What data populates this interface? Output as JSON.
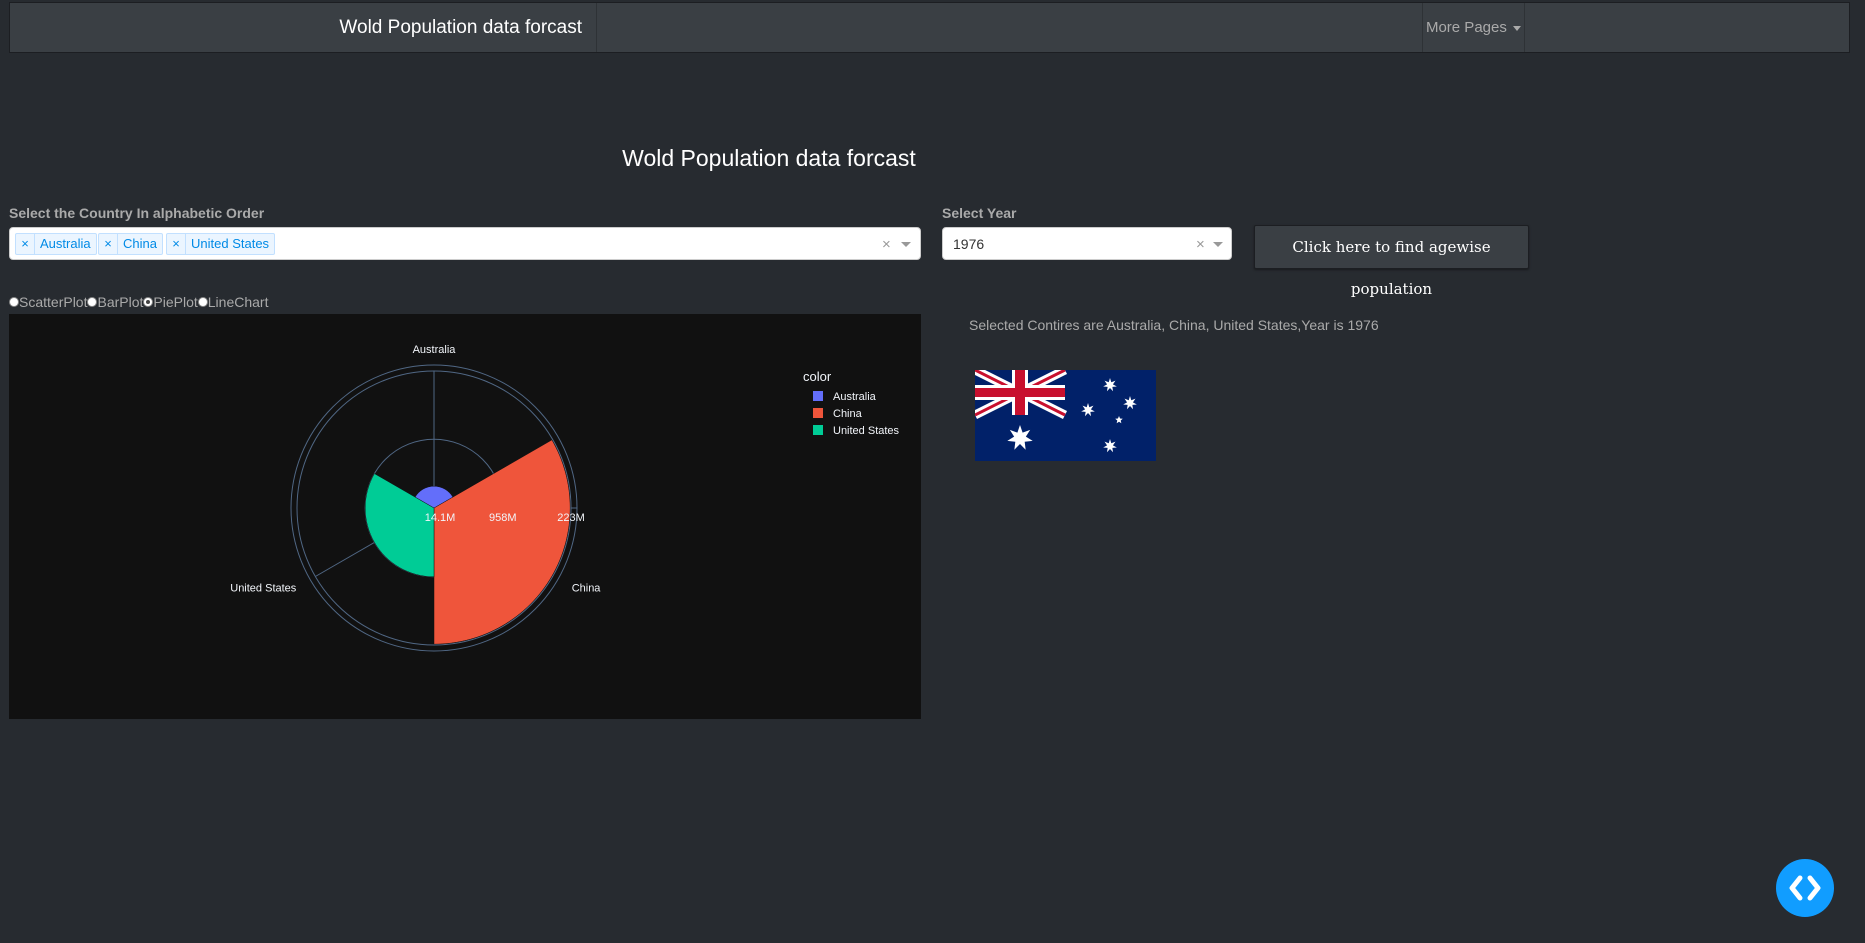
{
  "navbar": {
    "brand": "Wold Population data forcast",
    "more_pages": "More Pages"
  },
  "page_title": "Wold Population data forcast",
  "country_select": {
    "label": "Select the Country In alphabetic Order",
    "tags": [
      "Australia",
      "China",
      "United States"
    ]
  },
  "year_select": {
    "label": "Select Year",
    "value": "1976"
  },
  "agewise_button": "Click here to find agewise population",
  "plot_types": [
    {
      "label": "ScatterPlot",
      "checked": false
    },
    {
      "label": "BarPlot",
      "checked": false
    },
    {
      "label": "PiePlot",
      "checked": true
    },
    {
      "label": "LineChart",
      "checked": false
    }
  ],
  "selected_text": "Selected Contires are Australia, China, United States,Year is 1976",
  "chart_data": {
    "type": "barpolar",
    "categories": [
      "Australia",
      "China",
      "United States"
    ],
    "values": [
      14.1,
      958,
      223
    ],
    "units": "M",
    "radial_ticks": [
      "14.1M",
      "958M",
      "223M"
    ],
    "angular_labels": [
      "Australia",
      "China",
      "United States"
    ],
    "legend": {
      "title": "color",
      "entries": [
        {
          "name": "Australia",
          "color": "#636efa"
        },
        {
          "name": "China",
          "color": "#ef553b"
        },
        {
          "name": "United States",
          "color": "#00cc96"
        }
      ],
      "position": "top-right"
    },
    "background": "#111111"
  },
  "flag": {
    "country": "Australia"
  },
  "fab_icon": "code-icon"
}
